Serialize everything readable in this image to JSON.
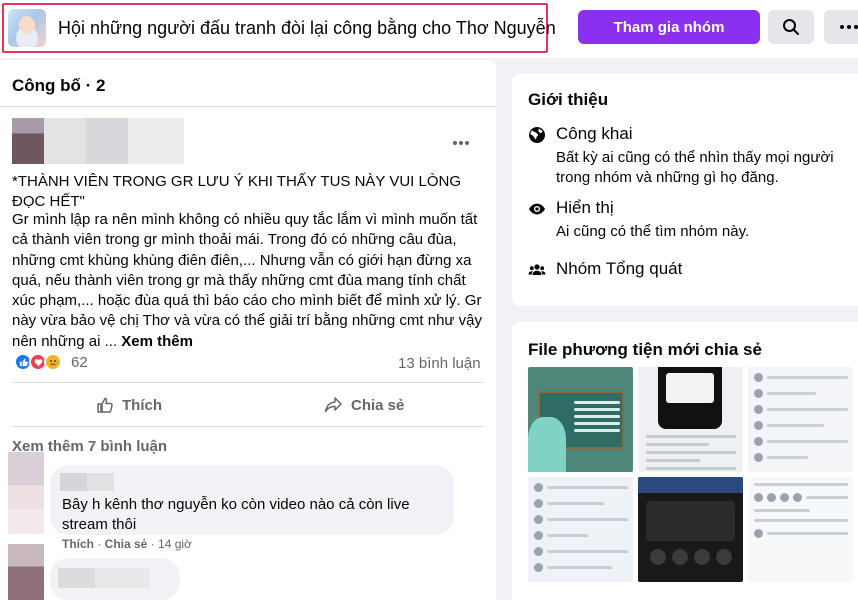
{
  "header": {
    "group_name": "Hội những người đấu tranh đòi lại công bằng cho Thơ Nguyễn",
    "join_label": "Tham gia nhóm",
    "search_icon": "search-icon",
    "more_icon": "more-icon"
  },
  "feed": {
    "section_title": "Công bố · 2",
    "post": {
      "heading": "*THÀNH VIÊN TRONG GR LƯU Ý KHI THẤY TUS NÀY VUI LÒNG ĐỌC HẾT\"",
      "body": "Gr mình lập ra nên mình không có nhiều quy tắc lắm vì mình muốn tất cả thành viên trong gr mình thoải mái. Trong đó có những câu đùa, những cmt khùng khùng điên điên,... Nhưng vẫn có giới hạn đừng xa quá, nếu thành viên trong gr mà thấy những cmt đùa mang tính chất xúc phạm,... hoặc đùa quá thì báo cáo cho mình biết để mình xử lý. Gr này vừa bảo vệ chị Thơ và vừa có thể giải trí bằng những cmt như vậy nên những ai ...",
      "see_more": "Xem thêm",
      "reaction_count": "62",
      "comment_count": "13 bình luận",
      "like_label": "Thích",
      "share_label": "Chia sẻ"
    },
    "more_comments": "Xem thêm 7 bình luận",
    "comment": {
      "text": "Bây h kênh thơ nguyễn ko còn video nào cả còn live stream thôi",
      "like": "Thích",
      "share": "Chia sẻ",
      "time": "14 giờ"
    }
  },
  "about": {
    "title": "Giới thiệu",
    "public_title": "Công khai",
    "public_desc": "Bất kỳ ai cũng có thể nhìn thấy mọi người trong nhóm và những gì họ đăng.",
    "visible_title": "Hiển thị",
    "visible_desc": "Ai cũng có thể tìm nhóm này.",
    "type_title": "Nhóm Tổng quát"
  },
  "media": {
    "title": "File phương tiện mới chia sẻ"
  },
  "colors": {
    "accent": "#8b2ff1",
    "highlight_border": "#e8335a"
  }
}
